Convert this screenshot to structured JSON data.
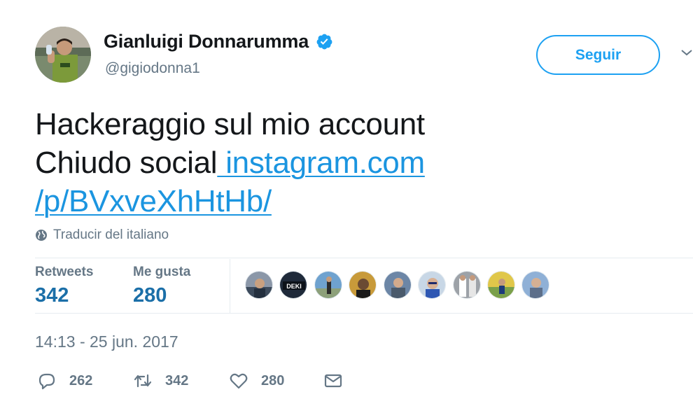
{
  "header": {
    "display_name": "Gianluigi Donnarumma",
    "handle": "@gigiodonna1",
    "avatar_icon": "profile-photo",
    "verified_icon": "verified-badge-icon",
    "follow_label": "Seguir",
    "menu_icon": "chevron-down-icon"
  },
  "tweet": {
    "line1": "Hackeraggio sul mio account",
    "line2_text": "Chiudo social",
    "link_part1": " instagram.com",
    "link_part2": "/p/BVxveXhHtHb/",
    "translate_label": "Traducir del italiano",
    "translate_icon": "globe-icon"
  },
  "stats": {
    "retweets_label": "Retweets",
    "retweets_count": "342",
    "likes_label": "Me gusta",
    "likes_count": "280",
    "likers": [
      {
        "icon": "liker-avatar"
      },
      {
        "icon": "liker-avatar"
      },
      {
        "icon": "liker-avatar"
      },
      {
        "icon": "liker-avatar"
      },
      {
        "icon": "liker-avatar"
      },
      {
        "icon": "liker-avatar"
      },
      {
        "icon": "liker-avatar"
      },
      {
        "icon": "liker-avatar"
      },
      {
        "icon": "liker-avatar"
      }
    ]
  },
  "timestamp": "14:13 - 25 jun. 2017",
  "actions": {
    "reply_count": "262",
    "retweet_count": "342",
    "like_count": "280",
    "reply_icon": "reply-icon",
    "retweet_icon": "retweet-icon",
    "like_icon": "heart-icon",
    "dm_icon": "envelope-icon"
  },
  "colors": {
    "accent": "#1da1f2",
    "link": "#1b95e0",
    "muted": "#657786",
    "count": "#1b6fa8"
  }
}
